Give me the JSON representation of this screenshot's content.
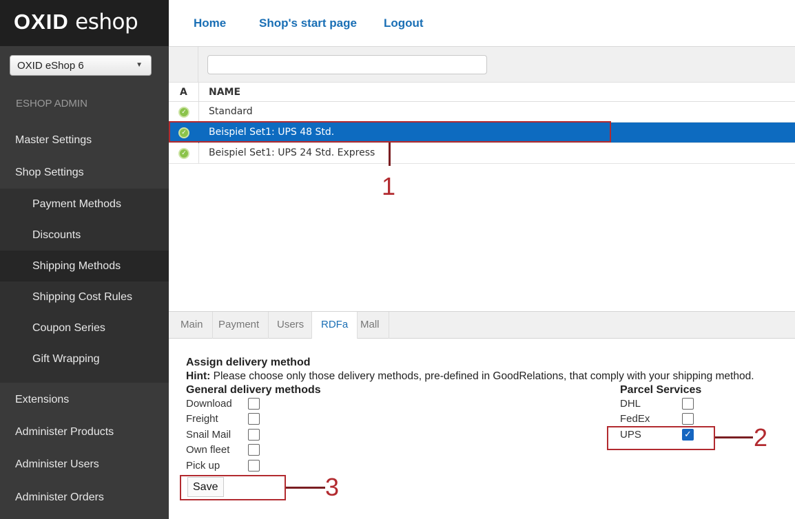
{
  "app": {
    "logo_brand": "OXID",
    "logo_sub": "eshop"
  },
  "shop_select": {
    "value": "OXID eShop 6",
    "arrow": "▼"
  },
  "sidebar": {
    "section_label": "ESHOP ADMIN",
    "items": [
      {
        "label": "Master Settings"
      },
      {
        "label": "Shop Settings"
      },
      {
        "label": "Payment Methods"
      },
      {
        "label": "Discounts"
      },
      {
        "label": "Shipping Methods"
      },
      {
        "label": "Shipping Cost Rules"
      },
      {
        "label": "Coupon Series"
      },
      {
        "label": "Gift Wrapping"
      },
      {
        "label": "Extensions"
      },
      {
        "label": "Administer Products"
      },
      {
        "label": "Administer Users"
      },
      {
        "label": "Administer Orders"
      }
    ]
  },
  "topnav": {
    "home": "Home",
    "start": "Shop's start page",
    "logout": "Logout"
  },
  "list": {
    "filter_value": "",
    "col_a": "A",
    "col_name": "NAME",
    "rows": [
      {
        "name": "Standard",
        "active": true
      },
      {
        "name": "Beispiel Set1: UPS 48 Std.",
        "active": true,
        "selected": true
      },
      {
        "name": "Beispiel Set1: UPS 24 Std. Express",
        "active": true
      }
    ],
    "status_glyph": "✓"
  },
  "tabs": [
    {
      "label": "Main"
    },
    {
      "label": "Payment"
    },
    {
      "label": "Users"
    },
    {
      "label": "RDFa",
      "active": true
    },
    {
      "label": "Mall"
    }
  ],
  "form": {
    "title": "Assign delivery method",
    "hint_label": "Hint:",
    "hint_text": " Please choose only those delivery methods, pre-defined in GoodRelations, that comply with your shipping method.",
    "general_title": "General delivery methods",
    "general": [
      {
        "label": "Download",
        "checked": false
      },
      {
        "label": "Freight",
        "checked": false
      },
      {
        "label": "Snail Mail",
        "checked": false
      },
      {
        "label": "Own fleet",
        "checked": false
      },
      {
        "label": "Pick up",
        "checked": false
      }
    ],
    "parcel_title": "Parcel Services",
    "parcel": [
      {
        "label": "DHL",
        "checked": false
      },
      {
        "label": "FedEx",
        "checked": false
      },
      {
        "label": "UPS",
        "checked": true
      }
    ],
    "save_label": "Save",
    "check_glyph": "✓"
  },
  "annotations": {
    "n1": "1",
    "n2": "2",
    "n3": "3",
    "color": "#b22a2f"
  },
  "colors": {
    "sidebar_bg": "#3a3a3a",
    "link_blue": "#1a6fb5",
    "selected_row": "#0d6bc0"
  }
}
